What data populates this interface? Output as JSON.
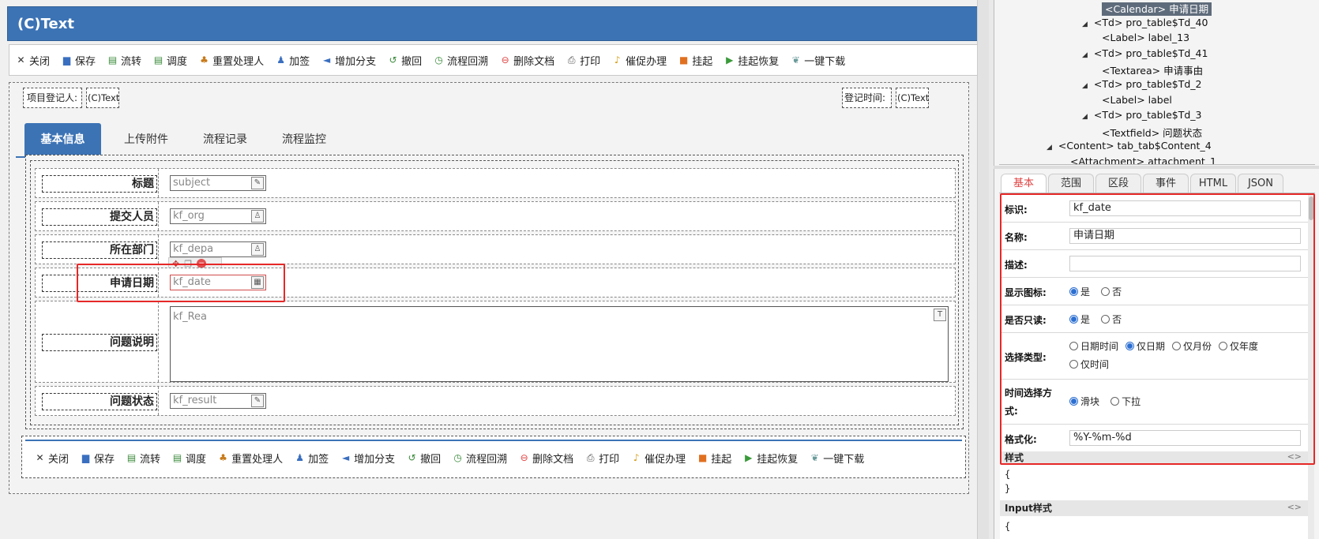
{
  "designer": {
    "title": "(C)Text",
    "toolbar": [
      {
        "label": "关闭",
        "icon": "close-icon",
        "glyph": "✕",
        "color": "#333"
      },
      {
        "label": "保存",
        "icon": "save-icon",
        "glyph": "▆",
        "color": "#3a6fc0"
      },
      {
        "label": "流转",
        "icon": "transfer-icon",
        "glyph": "▤",
        "color": "#3a8a3a"
      },
      {
        "label": "调度",
        "icon": "schedule-icon",
        "glyph": "▤",
        "color": "#3a8a3a"
      },
      {
        "label": "重置处理人",
        "icon": "reset-handler-icon",
        "glyph": "♣",
        "color": "#c77a1a"
      },
      {
        "label": "加签",
        "icon": "add-sign-icon",
        "glyph": "♟",
        "color": "#3a6fc0"
      },
      {
        "label": "增加分支",
        "icon": "add-branch-icon",
        "glyph": "◄",
        "color": "#3a6fc0"
      },
      {
        "label": "撤回",
        "icon": "withdraw-icon",
        "glyph": "↺",
        "color": "#3a8a3a"
      },
      {
        "label": "流程回溯",
        "icon": "flow-trace-icon",
        "glyph": "◷",
        "color": "#3a8a3a"
      },
      {
        "label": "删除文档",
        "icon": "delete-doc-icon",
        "glyph": "⊖",
        "color": "#e04040"
      },
      {
        "label": "打印",
        "icon": "print-icon",
        "glyph": "⎙",
        "color": "#555"
      },
      {
        "label": "催促办理",
        "icon": "urge-icon",
        "glyph": "♪",
        "color": "#d6a020"
      },
      {
        "label": "挂起",
        "icon": "suspend-icon",
        "glyph": "■",
        "color": "#e07020"
      },
      {
        "label": "挂起恢复",
        "icon": "resume-icon",
        "glyph": "▶",
        "color": "#3a9a3a"
      },
      {
        "label": "一键下载",
        "icon": "download-icon",
        "glyph": "❦",
        "color": "#6a9a9a"
      }
    ],
    "registrant_label": "项目登记人:",
    "registrant_value": "(C)Text",
    "reg_time_label": "登记时间:",
    "reg_time_value": "(C)Text",
    "tabs": [
      "基本信息",
      "上传附件",
      "流程记录",
      "流程监控"
    ],
    "fields": [
      {
        "label": "标题",
        "value": "subject",
        "icon": "edit-icon",
        "glyph": "✎"
      },
      {
        "label": "提交人员",
        "value": "kf_org",
        "icon": "user-icon",
        "glyph": "♙"
      },
      {
        "label": "所在部门",
        "value": "kf_depa",
        "icon": "dept-icon",
        "glyph": "♙"
      },
      {
        "label": "申请日期",
        "value": "kf_date",
        "icon": "calendar-icon",
        "glyph": "▦"
      }
    ],
    "textarea_label": "问题说明",
    "textarea_value": "kf_Rea",
    "status_label": "问题状态",
    "status_value": "kf_result"
  },
  "tree": [
    {
      "text": "<Calendar> 申请日期",
      "selected": true,
      "tri": false
    },
    {
      "text": "<Td> pro_table$Td_40",
      "selected": false,
      "tri": true
    },
    {
      "text": "<Label> label_13",
      "selected": false,
      "tri": false
    },
    {
      "text": "<Td> pro_table$Td_41",
      "selected": false,
      "tri": true
    },
    {
      "text": "<Textarea> 申请事由",
      "selected": false,
      "tri": false
    },
    {
      "text": "<Td> pro_table$Td_2",
      "selected": false,
      "tri": true
    },
    {
      "text": "<Label> label",
      "selected": false,
      "tri": false
    },
    {
      "text": "<Td> pro_table$Td_3",
      "selected": false,
      "tri": true
    },
    {
      "text": "<Textfield> 问题状态",
      "selected": false,
      "tri": false
    },
    {
      "text": "<Content> tab_tab$Content_4",
      "selected": false,
      "tri": true
    },
    {
      "text": "<Attachment> attachment_1",
      "selected": false,
      "tri": false
    }
  ],
  "prop_tabs": [
    "基本",
    "范围",
    "区段",
    "事件",
    "HTML",
    "JSON"
  ],
  "props": {
    "id_label": "标识:",
    "id_value": "kf_date",
    "name_label": "名称:",
    "name_value": "申请日期",
    "desc_label": "描述:",
    "desc_value": "",
    "show_icon_label": "显示图标:",
    "readonly_label": "是否只读:",
    "yes": "是",
    "no": "否",
    "select_type_label": "选择类型:",
    "select_types": [
      "日期时间",
      "仅日期",
      "仅月份",
      "仅年度",
      "仅时间"
    ],
    "select_type_selected": "仅日期",
    "time_mode_label_1": "时间选择方",
    "time_mode_label_2": "式:",
    "time_modes": [
      "滑块",
      "下拉"
    ],
    "format_label": "格式化:",
    "format_value": "%Y-%m-%d",
    "style_label": "样式",
    "style_code_1": "{",
    "style_code_2": "}",
    "input_style_label": "Input样式",
    "input_style_code": "{"
  }
}
